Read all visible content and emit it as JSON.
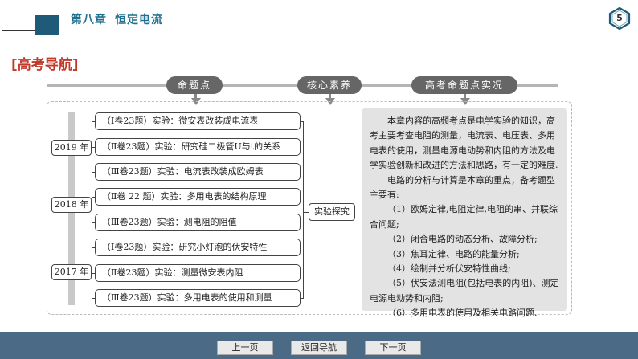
{
  "header": {
    "chapter": "第八章",
    "topic": "恒定电流",
    "page_number": "5"
  },
  "section_title": "[高考导航]",
  "pills": [
    "命题点",
    "核心素养",
    "高考命题点实况"
  ],
  "years": [
    "2019 年",
    "2018 年",
    "2017 年"
  ],
  "items": [
    "（Ⅰ卷23题）实验：微安表改装成电流表",
    "（Ⅱ卷23题）实验：研究硅二极管U与t的关系",
    "（Ⅲ卷23题）实验：电流表改装成欧姆表",
    "（Ⅱ卷 22 题）实验：多用电表的结构原理",
    "（Ⅲ卷23题）实验：测电阻的阻值",
    "（Ⅰ卷23题）实验：研究小灯泡的伏安特性",
    "（Ⅱ卷23题）实验：测量微安表内阻",
    "（Ⅲ卷23题）实验：多用电表的使用和测量"
  ],
  "experiment_label": "实验探究",
  "description": {
    "p1": "本章内容的高频考点是电学实验的知识，高考主要考查电阻的测量，电流表、电压表、多用电表的使用，测量电源电动势和内阻的方法及电学实验创新和改进的方法和思路，有一定的难度.",
    "p2": "电路的分析与计算是本章的重点，备考题型主要有:",
    "list": [
      "（1）欧姆定律,电阻定律,电阻的串、并联综合问题;",
      "（2）闭合电路的动态分析、故障分析;",
      "（3）焦耳定律、电路的能量分析;",
      "（4）绘制并分析伏安特性曲线;",
      "（5）伏安法测电阻(包括电表的内阻)、测定电源电动势和内阻;",
      "（6）多用电表的使用及相关电路问题."
    ]
  },
  "footer": {
    "prev": "上一页",
    "back": "返回导航",
    "next": "下一页"
  }
}
